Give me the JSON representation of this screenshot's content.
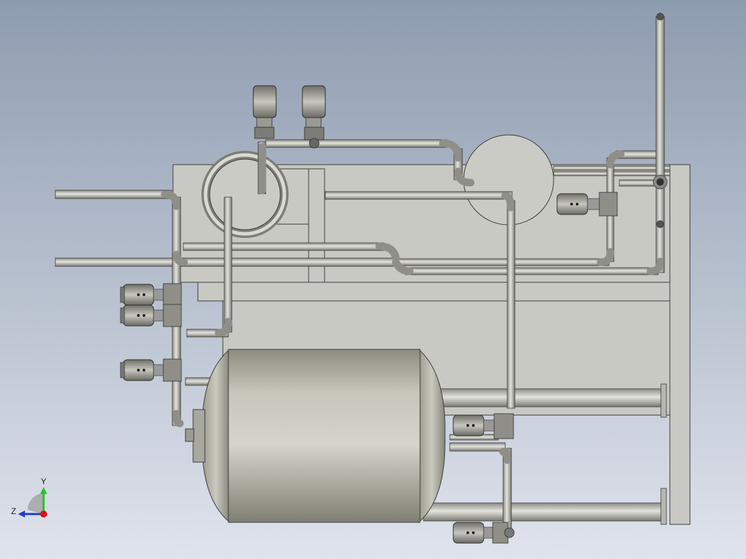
{
  "scene": {
    "background_top": "#8e9cb0",
    "background_bottom": "#dfe3ec",
    "frame_color": "#c9c9c4",
    "pipe_color": "#bcbcb6",
    "valve_color": "#a7a7a1",
    "tank_color": "#b9b9ad"
  },
  "triad": {
    "y_label": "Y",
    "z_label": "Z",
    "y_color": "#1ec81e",
    "z_color": "#1f3ccc",
    "x_color": "#e01010"
  },
  "icons": [
    "coordinate-triad-icon"
  ]
}
